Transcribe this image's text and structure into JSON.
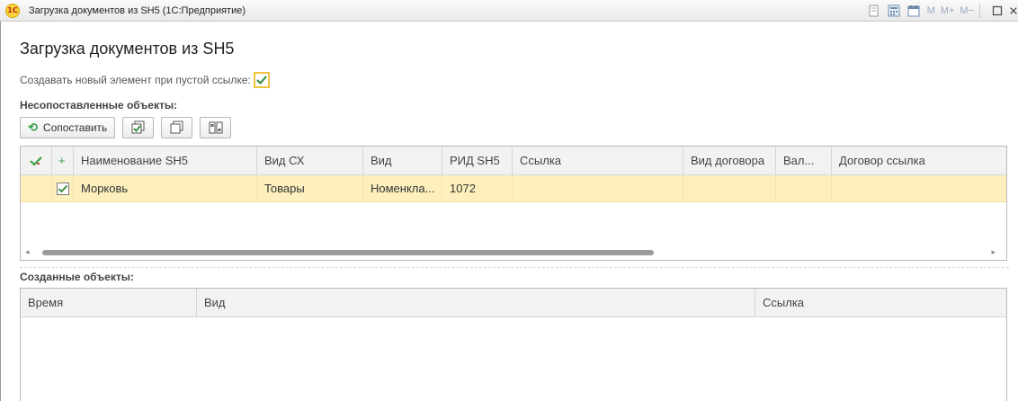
{
  "window": {
    "logo_text": "1С",
    "title": "Загрузка документов из SH5  (1С:Предприятие)",
    "tools": {
      "mem_m": "M",
      "mem_mplus": "M+",
      "mem_mminus": "M−"
    }
  },
  "form": {
    "title": "Загрузка документов из SH5",
    "create_new_label": "Создавать новый элемент при пустой ссылке:",
    "create_new_checked": true
  },
  "unmatched": {
    "title": "Несопоставленные объекты:",
    "toolbar": {
      "match_label": "Сопоставить"
    },
    "columns": {
      "check": "",
      "plus": "+",
      "name": "Наименование SH5",
      "vid_sx": "Вид СХ",
      "vid": "Вид",
      "rid": "РИД SH5",
      "link": "Ссылка",
      "contract_type": "Вид договора",
      "currency": "Вал...",
      "contract_link": "Договор ссылка"
    },
    "rows": [
      {
        "checked": true,
        "name": "Морковь",
        "vid_sx": "Товары",
        "vid": "Номенкла...",
        "rid": "1072",
        "link": "",
        "contract_type": "",
        "currency": "",
        "contract_link": ""
      }
    ],
    "scroll_position": 0.0,
    "scroll_visible_fraction": 0.64
  },
  "created": {
    "title": "Созданные объекты:",
    "columns": {
      "time": "Время",
      "vid": "Вид",
      "link": "Ссылка"
    }
  },
  "colors": {
    "accent_yellow": "#f0c342",
    "row_highlight": "#fdf0bd",
    "check_green": "#3aa14a"
  }
}
